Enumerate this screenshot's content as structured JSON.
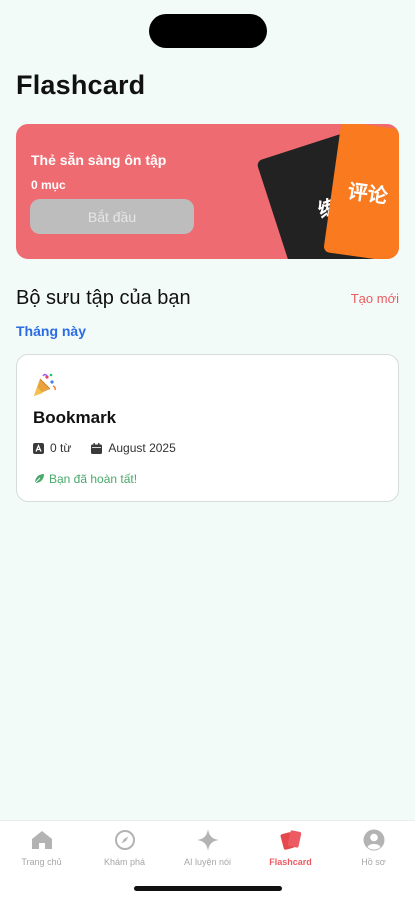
{
  "header": {
    "title": "Flashcard"
  },
  "review": {
    "title": "Thẻ sẵn sàng ôn tập",
    "count": "0 mục",
    "start_label": "Bắt đầu",
    "card_black_text": "练习",
    "card_orange_text": "评论"
  },
  "collections": {
    "title": "Bộ sưu tập của bạn",
    "create_label": "Tạo mới",
    "filter_label": "Tháng này",
    "items": [
      {
        "name": "Bookmark",
        "words": "0 từ",
        "date": "August 2025",
        "status": "Bạn đã hoàn tất!"
      }
    ]
  },
  "tabs": [
    {
      "label": "Trang chủ",
      "icon": "home-icon"
    },
    {
      "label": "Khám phá",
      "icon": "compass-icon"
    },
    {
      "label": "AI luyện nói",
      "icon": "sparkle-icon"
    },
    {
      "label": "Flashcard",
      "icon": "flashcard-icon",
      "active": true
    },
    {
      "label": "Hồ sơ",
      "icon": "profile-icon"
    }
  ],
  "colors": {
    "accent": "#ec5b61",
    "review_card": "#ee6b71",
    "link_blue": "#2b6be4",
    "success_green": "#49a86a",
    "background": "#f3fbf9"
  }
}
